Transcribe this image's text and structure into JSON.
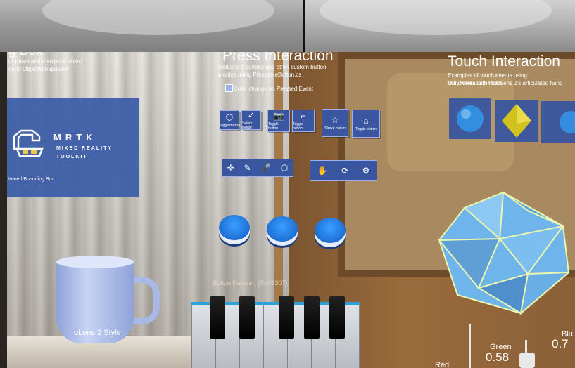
{
  "left_panel": {
    "title": "g Box",
    "line1": "or rotate and manipulat object",
    "line2": "ound ObjectManipulator",
    "mrtk_title": "MRTK",
    "mrtk_sub1": "MIXED REALITY",
    "mrtk_sub2": "TOOLKIT",
    "footer": "ttened Bounding Box"
  },
  "press": {
    "title": "Press Interaction",
    "desc1": "loloLens 2 buttons and other custom button",
    "desc2": "amples using PressableButton.cs",
    "checkbox_label": "Color change on Pressed Event",
    "row1": [
      {
        "icon": "cube-icon",
        "glyph": "⬡",
        "label": "ToggleButton"
      },
      {
        "icon": "check-icon",
        "glyph": "✓",
        "label": "Select toggle"
      },
      {
        "icon": "camera-icon",
        "glyph": "📷",
        "label": "Toggle button"
      },
      {
        "icon": "bracket-icon",
        "glyph": "⌐",
        "label": "Toggle button"
      },
      {
        "icon": "star-icon",
        "glyph": "☆",
        "label": "Stroke button"
      },
      {
        "icon": "scan-icon",
        "glyph": "⌂",
        "label": "Toggle button"
      }
    ],
    "bar_left": [
      "✛",
      "✎",
      "🎤",
      "⬡"
    ],
    "bar_right": [
      "✋",
      "⟳",
      "⚙"
    ],
    "round_buttons": 3,
    "piano_label": "Button Pressed (Surf3307)"
  },
  "touch": {
    "title": "Touch Interaction",
    "desc1": "Examples of touch events using HandInteractionTouch",
    "desc2": "Only works with HoloLens 2's articulated hand"
  },
  "mug_label": "oLens 2 Style",
  "sliders": {
    "red_label": "Red",
    "green_label": "Green",
    "green_value": "0.58",
    "blue_label": "Blu",
    "blue_value": "0.7"
  },
  "colors": {
    "panel_blue": "#3a56a0",
    "button_blue": "#1e6fd6",
    "ico_blue": "#6fb4ea",
    "gem_yellow": "#d4c51a"
  }
}
